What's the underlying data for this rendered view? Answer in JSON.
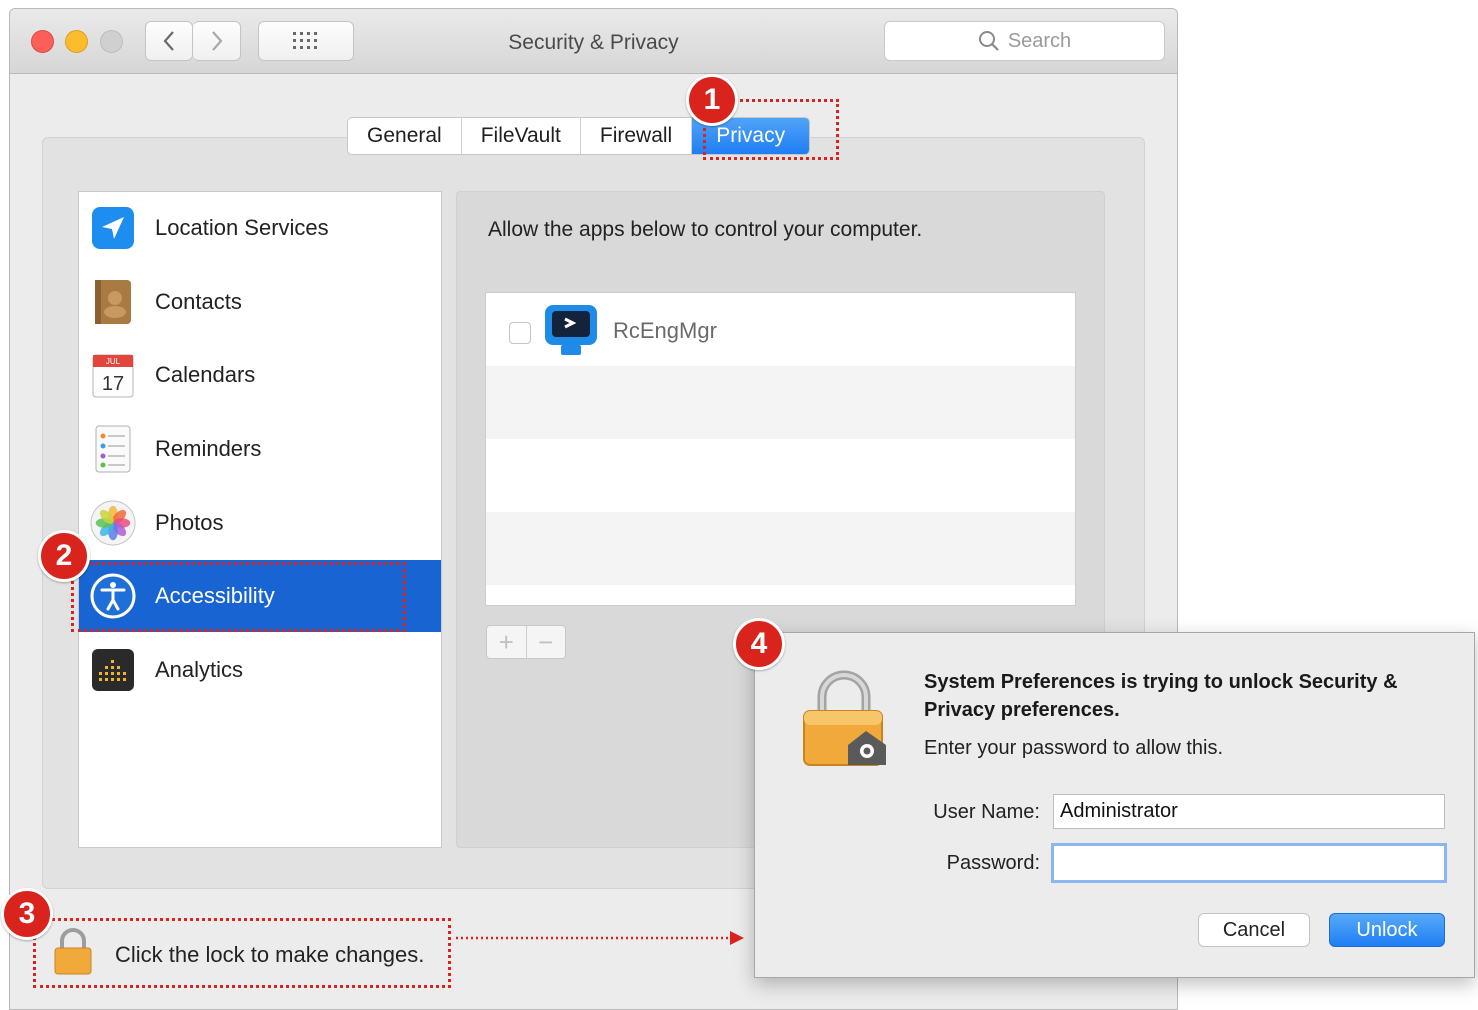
{
  "window": {
    "title": "Security & Privacy",
    "search_placeholder": "Search"
  },
  "tabs": [
    "General",
    "FileVault",
    "Firewall",
    "Privacy"
  ],
  "active_tab": "Privacy",
  "sidebar": {
    "items": [
      {
        "label": "Location Services",
        "icon": "location-arrow-icon"
      },
      {
        "label": "Contacts",
        "icon": "contacts-book-icon"
      },
      {
        "label": "Calendars",
        "icon": "calendar-icon"
      },
      {
        "label": "Reminders",
        "icon": "reminders-list-icon"
      },
      {
        "label": "Photos",
        "icon": "photos-flower-icon"
      },
      {
        "label": "Accessibility",
        "icon": "accessibility-icon"
      },
      {
        "label": "Analytics",
        "icon": "analytics-grid-icon"
      }
    ],
    "selected": "Accessibility",
    "calendar_month": "JUL",
    "calendar_day": "17"
  },
  "main": {
    "description": "Allow the apps below to control your computer.",
    "apps": [
      {
        "name": "RcEngMgr",
        "checked": false,
        "icon": "rcengmgr-app-icon"
      }
    ],
    "add_label": "+",
    "remove_label": "−"
  },
  "lock": {
    "text": "Click the lock to make changes."
  },
  "dialog": {
    "title": "System Preferences is trying to unlock Security & Privacy preferences.",
    "subtitle": "Enter your password to allow this.",
    "username_label": "User Name:",
    "username_value": "Administrator",
    "password_label": "Password:",
    "password_value": "",
    "cancel_label": "Cancel",
    "unlock_label": "Unlock"
  },
  "annotations": {
    "badges": [
      "1",
      "2",
      "3",
      "4"
    ],
    "color": "#d9231d"
  },
  "colors": {
    "accent": "#1f7ef3",
    "selection": "#1864d3"
  }
}
